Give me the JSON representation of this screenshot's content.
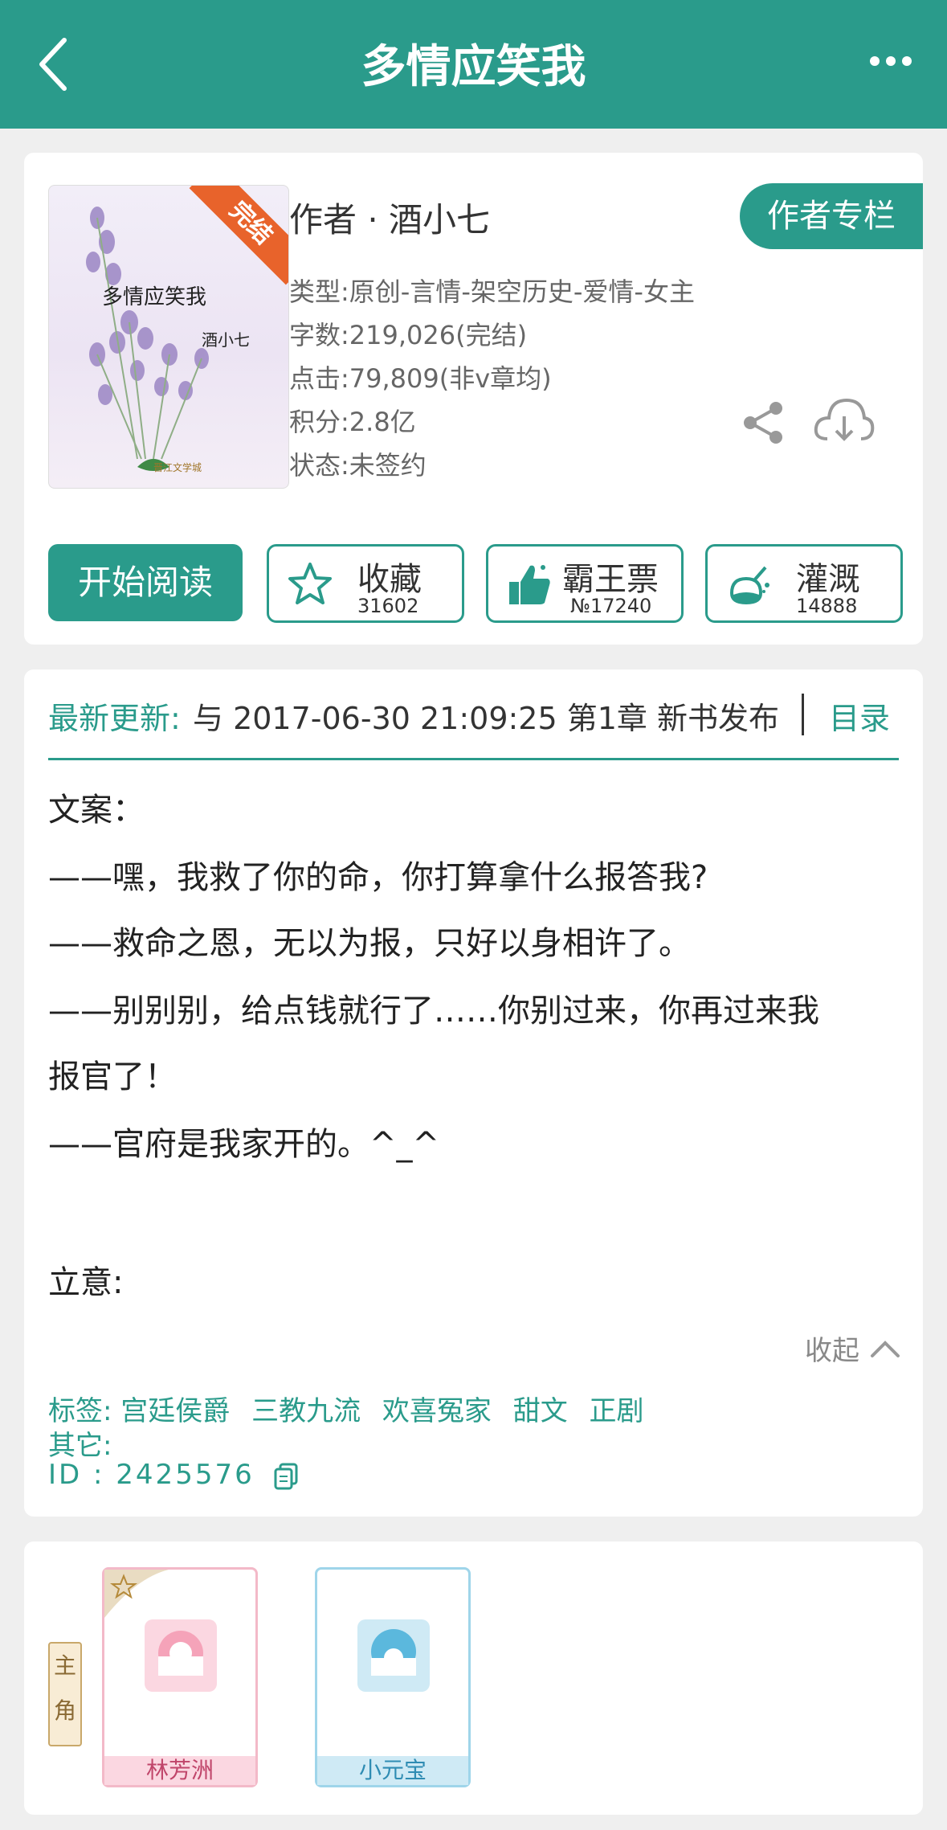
{
  "header": {
    "title": "多情应笑我"
  },
  "book": {
    "cover_title": "多情应笑我",
    "cover_author": "酒小七",
    "cover_badge": "完结",
    "author_line": "作者 · 酒小七",
    "author_button": "作者专栏",
    "genre": "类型:原创-言情-架空历史-爱情-女主",
    "words": "字数:219,026(完结)",
    "clicks": "点击:79,809(非v章均)",
    "points": "积分:2.8亿",
    "status": "状态:未签约"
  },
  "actions": {
    "read": "开始阅读",
    "collect": {
      "label": "收藏",
      "count": "31602"
    },
    "vote": {
      "label": "霸王票",
      "count": "№17240"
    },
    "water": {
      "label": "灌溉",
      "count": "14888"
    }
  },
  "update": {
    "label": "最新更新:",
    "text": "与 2017-06-30 21:09:25   第1章  新书发布",
    "toc": "目录"
  },
  "description": {
    "lines": [
      "文案：",
      "——嘿，我救了你的命，你打算拿什么报答我?",
      "——救命之恩，无以为报，只好以身相许了。",
      "——别别别，给点钱就行了……你别过来，你再过来我",
      "报官了！",
      "——官府是我家开的。^_^",
      "立意:"
    ],
    "collapse": "收起"
  },
  "tags": {
    "label": "标签:",
    "items": [
      "宫廷侯爵",
      "三教九流",
      "欢喜冤家",
      "甜文",
      "正剧"
    ],
    "other_label": "其它:",
    "id_label": "ID   :",
    "id_value": "2425576"
  },
  "characters": {
    "role": "主角",
    "items": [
      {
        "name": "林芳洲"
      },
      {
        "name": "小元宝"
      }
    ]
  },
  "colors": {
    "accent": "#2a9b8b",
    "badge": "#e8632b"
  }
}
